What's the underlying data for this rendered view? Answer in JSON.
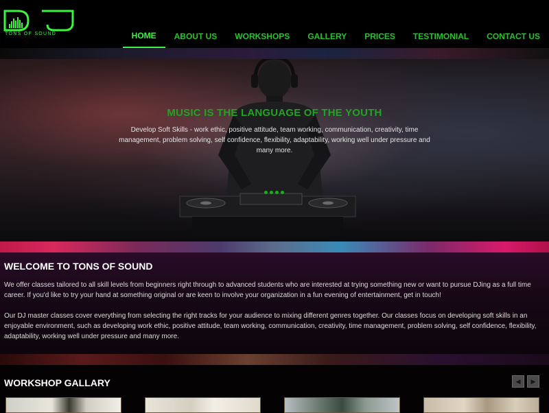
{
  "brand": {
    "logo_letters": "DJ",
    "logo_tagline": "TONS OF SOUND",
    "accent_color": "#3cf33f"
  },
  "nav": {
    "items": [
      "HOME",
      "ABOUT US",
      "WORKSHOPS",
      "GALLERY",
      "PRICES",
      "TESTIMONIAL",
      "CONTACT US"
    ],
    "active": "HOME"
  },
  "hero": {
    "title": "MUSIC IS THE LANGUAGE OF THE YOUTH",
    "text": "Develop Soft Skills - work ethic, positive attitude, team working, communication, creativity, time management, problem solving, self confidence, flexibility, adaptability, working well under pressure and many more.",
    "slide_count": 4
  },
  "welcome": {
    "heading": "WELCOME TO TONS OF SOUND",
    "paragraph1": "We offer classes tailored to all skill levels from beginners right through to advanced students who are interested at trying something new or want to pursue DJing as a full time career. If you'd like to try your hand at something original or are keen to involve your organization in a fun evening of entertainment, get in touch!",
    "paragraph2": "Our DJ master classes cover everything from selecting the right tracks for your audience to mixing different genres together. Our classes focus on developing soft skills in an enjoyable environment, such as developing work ethic, positive attitude, team working, communication, creativity, time management, problem solving, self confidence, flexibility, adaptability, working well under pressure and many more."
  },
  "gallery": {
    "heading": "WORKSHOP GALLARY",
    "prev_icon": "arrow-left-icon",
    "next_icon": "arrow-right-icon",
    "thumbnail_count": 4
  }
}
